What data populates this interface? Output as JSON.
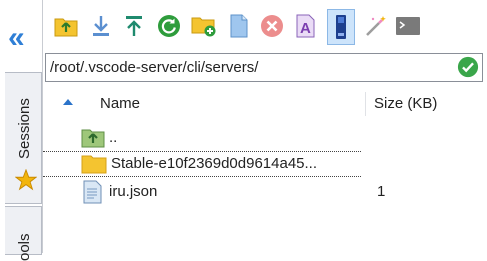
{
  "sidebar": {
    "tabs": [
      {
        "label": "Sessions"
      },
      {
        "label": "ools"
      }
    ]
  },
  "path": {
    "value": "/root/.vscode-server/cli/servers/"
  },
  "table": {
    "columns": [
      "Name",
      "Size (KB)"
    ],
    "rows": [
      {
        "name": "..",
        "size": "",
        "type": "parent"
      },
      {
        "name": "Stable-e10f2369d0d9614a45...",
        "size": "",
        "type": "folder"
      },
      {
        "name": "iru.json",
        "size": "1",
        "type": "file"
      }
    ]
  },
  "colors": {
    "accent": "#2f7fd6",
    "folder": "#f4c430",
    "ok": "#3aa64a"
  }
}
